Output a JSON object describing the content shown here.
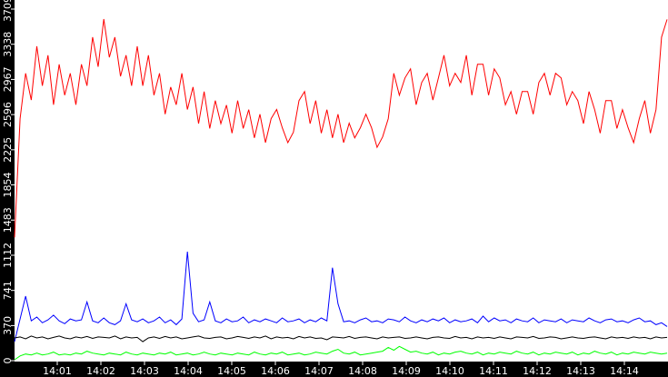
{
  "chart_data": {
    "type": "line",
    "title": "",
    "xlabel": "",
    "ylabel": "",
    "x_unit": "minutes after 14:00",
    "x_start": 0.02,
    "x_step": 0.2083,
    "xlim": [
      0,
      14.98
    ],
    "ylim": [
      0,
      3800
    ],
    "y_ticks": [
      0,
      370,
      741,
      1112,
      1483,
      1854,
      2225,
      2596,
      2967,
      3338,
      3709
    ],
    "x_ticks": [
      {
        "v": 1,
        "label": "14:01"
      },
      {
        "v": 2,
        "label": "14:02"
      },
      {
        "v": 3,
        "label": "14:03"
      },
      {
        "v": 4,
        "label": "14:04"
      },
      {
        "v": 5,
        "label": "14:05"
      },
      {
        "v": 6,
        "label": "14:06"
      },
      {
        "v": 7,
        "label": "14:07"
      },
      {
        "v": 8,
        "label": "14:08"
      },
      {
        "v": 9,
        "label": "14:09"
      },
      {
        "v": 10,
        "label": "14:10"
      },
      {
        "v": 11,
        "label": "14:11"
      },
      {
        "v": 12,
        "label": "14:12"
      },
      {
        "v": 13,
        "label": "14:13"
      },
      {
        "v": 14,
        "label": "14:14"
      }
    ],
    "grid": false,
    "series": [
      {
        "name": "red",
        "color": "#ff0000",
        "values": [
          1300,
          2553,
          3031,
          2750,
          3317,
          2900,
          3222,
          2700,
          3126,
          2800,
          3031,
          2700,
          3126,
          2900,
          3413,
          3100,
          3604,
          3200,
          3413,
          3000,
          3222,
          2900,
          3317,
          2900,
          3222,
          2800,
          3031,
          2600,
          2887,
          2700,
          3031,
          2650,
          2887,
          2500,
          2839,
          2450,
          2744,
          2500,
          2696,
          2400,
          2744,
          2450,
          2648,
          2350,
          2600,
          2300,
          2553,
          2650,
          2457,
          2300,
          2409,
          2744,
          2839,
          2500,
          2744,
          2400,
          2648,
          2350,
          2600,
          2300,
          2505,
          2350,
          2457,
          2600,
          2457,
          2250,
          2361,
          2553,
          3031,
          2800,
          2983,
          3078,
          2700,
          2935,
          3031,
          2750,
          2983,
          3222,
          2900,
          3031,
          2935,
          3222,
          2800,
          3126,
          3126,
          2800,
          3078,
          2983,
          2700,
          2839,
          2600,
          2839,
          2839,
          2600,
          2935,
          3031,
          2800,
          3031,
          2983,
          2700,
          2839,
          2744,
          2500,
          2839,
          2648,
          2400,
          2744,
          2744,
          2450,
          2648,
          2457,
          2300,
          2553,
          2744,
          2400,
          2648,
          3413,
          3600
        ]
      },
      {
        "name": "blue",
        "color": "#0000ff",
        "values": [
          200,
          440,
          680,
          420,
          460,
          400,
          430,
          480,
          420,
          390,
          440,
          420,
          430,
          620,
          420,
          400,
          450,
          400,
          380,
          420,
          600,
          430,
          410,
          440,
          400,
          420,
          460,
          400,
          430,
          380,
          440,
          1150,
          500,
          410,
          430,
          620,
          420,
          400,
          440,
          410,
          420,
          460,
          400,
          430,
          410,
          440,
          420,
          400,
          450,
          410,
          420,
          440,
          400,
          430,
          410,
          450,
          420,
          980,
          600,
          410,
          420,
          400,
          430,
          450,
          410,
          420,
          400,
          440,
          430,
          410,
          460,
          420,
          400,
          430,
          410,
          440,
          420,
          450,
          400,
          430,
          410,
          420,
          440,
          400,
          470,
          410,
          450,
          420,
          430,
          400,
          440,
          420,
          410,
          450,
          400,
          430,
          420,
          410,
          440,
          400,
          430,
          420,
          410,
          450,
          420,
          400,
          430,
          440,
          410,
          420,
          400,
          430,
          450,
          410,
          420,
          380,
          400,
          360
        ]
      },
      {
        "name": "black",
        "color": "#000000",
        "values": [
          240,
          250,
          230,
          260,
          240,
          250,
          230,
          245,
          260,
          240,
          230,
          250,
          240,
          255,
          235,
          250,
          245,
          240,
          260,
          230,
          250,
          240,
          245,
          200,
          240,
          250,
          235,
          255,
          240,
          250,
          230,
          240,
          250,
          260,
          240,
          235,
          245,
          250,
          230,
          240,
          255,
          245,
          235,
          250,
          240,
          260,
          230,
          250,
          240,
          245,
          230,
          255,
          240,
          250,
          235,
          240,
          220,
          250,
          245,
          240,
          255,
          235,
          245,
          250,
          240,
          230,
          250,
          240,
          245,
          250,
          235,
          240,
          250,
          240,
          230,
          245,
          250,
          240,
          235,
          255,
          240,
          245,
          230,
          250,
          240,
          245,
          235,
          250,
          240,
          230,
          250,
          245,
          240,
          255,
          235,
          240,
          250,
          245,
          230,
          240,
          250,
          240,
          235,
          245,
          250,
          240,
          230,
          250,
          240,
          245,
          235,
          250,
          240,
          245,
          230,
          250,
          240,
          245
        ]
      },
      {
        "name": "green",
        "color": "#00ff00",
        "values": [
          10,
          50,
          70,
          60,
          80,
          60,
          70,
          90,
          60,
          70,
          60,
          80,
          70,
          100,
          80,
          70,
          60,
          80,
          70,
          60,
          90,
          70,
          60,
          80,
          70,
          60,
          80,
          70,
          90,
          60,
          70,
          80,
          60,
          70,
          90,
          70,
          60,
          80,
          70,
          60,
          80,
          70,
          60,
          90,
          70,
          60,
          80,
          70,
          90,
          60,
          70,
          80,
          60,
          70,
          90,
          80,
          70,
          100,
          120,
          80,
          70,
          90,
          60,
          70,
          80,
          90,
          100,
          140,
          110,
          150,
          120,
          90,
          100,
          80,
          70,
          90,
          60,
          80,
          70,
          90,
          100,
          80,
          70,
          90,
          60,
          80,
          70,
          90,
          80,
          70,
          100,
          80,
          70,
          90,
          60,
          80,
          70,
          90,
          80,
          70,
          90,
          60,
          80,
          70,
          100,
          80,
          70,
          90,
          60,
          80,
          70,
          90,
          80,
          70,
          90,
          80,
          70,
          80
        ]
      }
    ]
  }
}
